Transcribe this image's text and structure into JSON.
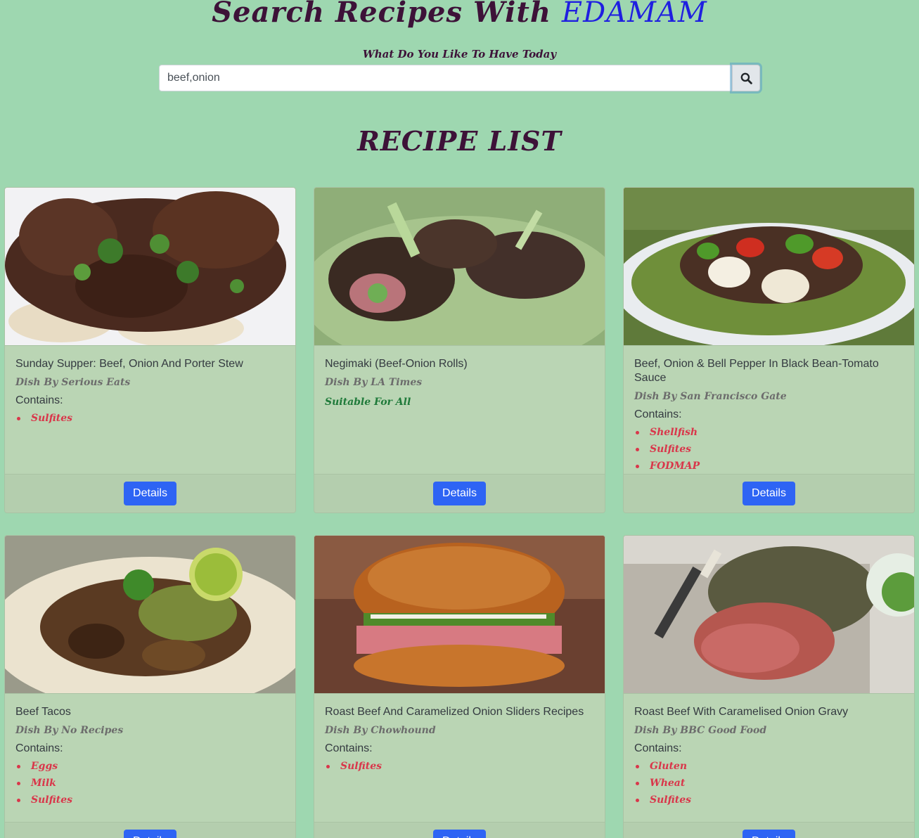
{
  "header": {
    "title_prefix": "Search Recipes With",
    "title_brand": "EDAMAM",
    "subtitle": "What Do You Like To Have Today"
  },
  "search": {
    "value": "beef,onion",
    "button_icon": "search-icon"
  },
  "list_heading": "RECIPE LIST",
  "contains_label": "Contains:",
  "details_label": "Details",
  "recipes": [
    {
      "title": "Sunday Supper: Beef, Onion And Porter Stew",
      "source": "Dish By Serious Eats",
      "allergens": [
        "Sulfites"
      ],
      "suitable": ""
    },
    {
      "title": "Negimaki (Beef-Onion Rolls)",
      "source": "Dish By LA Times",
      "allergens": [],
      "suitable": "Suitable For All"
    },
    {
      "title": "Beef, Onion & Bell Pepper In Black Bean-Tomato Sauce",
      "source": "Dish By San Francisco Gate",
      "allergens": [
        "Shellfish",
        "Sulfites",
        "FODMAP"
      ],
      "suitable": ""
    },
    {
      "title": "Beef Tacos",
      "source": "Dish By No Recipes",
      "allergens": [
        "Eggs",
        "Milk",
        "Sulfites"
      ],
      "suitable": ""
    },
    {
      "title": "Roast Beef And Caramelized Onion Sliders Recipes",
      "source": "Dish By Chowhound",
      "allergens": [
        "Sulfites"
      ],
      "suitable": ""
    },
    {
      "title": "Roast Beef With Caramelised Onion Gravy",
      "source": "Dish By BBC Good Food",
      "allergens": [
        "Gluten",
        "Wheat",
        "Sulfites"
      ],
      "suitable": ""
    }
  ],
  "colors": {
    "background": "#9ed7b0",
    "heading": "#3d1238",
    "brand": "#1f1fe0",
    "allergen": "#d9364a",
    "suitable": "#1f7a3a",
    "button": "#2e64f4"
  }
}
